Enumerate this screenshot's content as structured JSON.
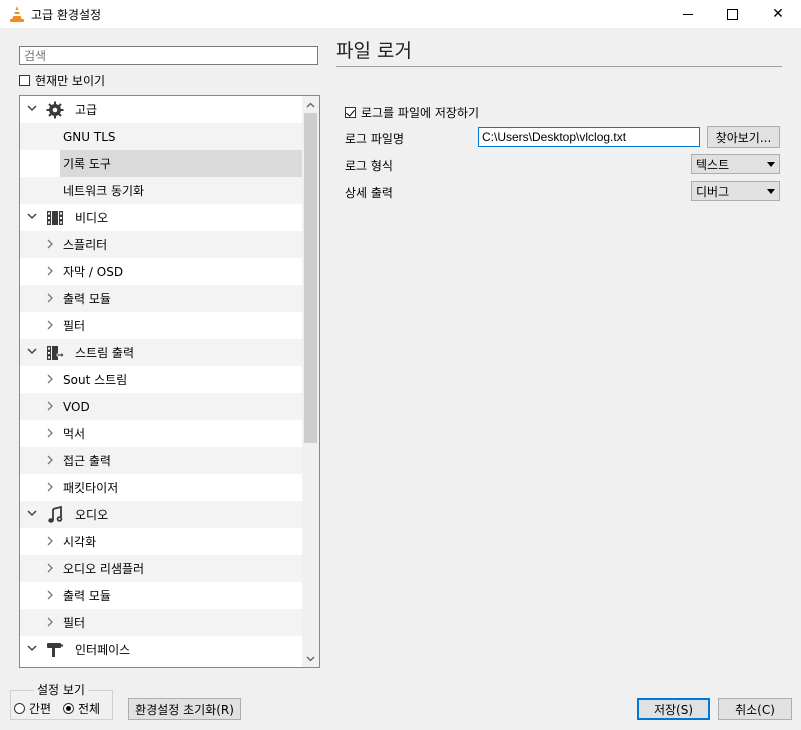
{
  "window": {
    "title": "고급 환경설정",
    "icon": "vlc-cone-icon",
    "controls": {
      "minimize": "minimize-icon",
      "maximize": "maximize-icon",
      "close": "✕"
    }
  },
  "sidebar": {
    "search": {
      "placeholder": "검색",
      "value": ""
    },
    "current_only": {
      "label": "현재만 보이기",
      "checked": false
    },
    "tree": [
      {
        "kind": "cat",
        "label": "고급",
        "icon": "gear-icon",
        "expanded": true
      },
      {
        "kind": "leaf",
        "label": "GNU TLS"
      },
      {
        "kind": "leaf",
        "label": "기록 도구",
        "selected": true
      },
      {
        "kind": "leaf",
        "label": "네트워크 동기화"
      },
      {
        "kind": "cat",
        "label": "비디오",
        "icon": "video-icon",
        "expanded": true
      },
      {
        "kind": "sub",
        "label": "스플리터"
      },
      {
        "kind": "sub",
        "label": "자막 / OSD"
      },
      {
        "kind": "sub",
        "label": "출력 모듈"
      },
      {
        "kind": "sub",
        "label": "필터"
      },
      {
        "kind": "cat",
        "label": "스트림 출력",
        "icon": "stream-output-icon",
        "expanded": true
      },
      {
        "kind": "sub",
        "label": "Sout 스트림"
      },
      {
        "kind": "sub",
        "label": "VOD"
      },
      {
        "kind": "sub",
        "label": "먹서"
      },
      {
        "kind": "sub",
        "label": "접근 출력"
      },
      {
        "kind": "sub",
        "label": "패킷타이저"
      },
      {
        "kind": "cat",
        "label": "오디오",
        "icon": "audio-icon",
        "expanded": true
      },
      {
        "kind": "sub",
        "label": "시각화"
      },
      {
        "kind": "sub",
        "label": "오디오 리샘플러"
      },
      {
        "kind": "sub",
        "label": "출력 모듈"
      },
      {
        "kind": "sub",
        "label": "필터"
      },
      {
        "kind": "cat",
        "label": "인터페이스",
        "icon": "interface-icon",
        "expanded": true
      }
    ]
  },
  "panel": {
    "title": "파일 로거",
    "save_to_file": {
      "label": "로그를 파일에 저장하기",
      "checked": true
    },
    "filename": {
      "label": "로그 파일명",
      "value": "C:\\Users\\Desktop\\vlclog.txt",
      "browse": "찾아보기..."
    },
    "format": {
      "label": "로그 형식",
      "value": "텍스트"
    },
    "verbosity": {
      "label": "상세 출력",
      "value": "디버그"
    }
  },
  "footer": {
    "view_group": "설정 보기",
    "simple": "간편",
    "all": "전체",
    "selected_view": "all",
    "reset": "환경설정 초기화(R)",
    "save": "저장(S)",
    "cancel": "취소(C)"
  }
}
